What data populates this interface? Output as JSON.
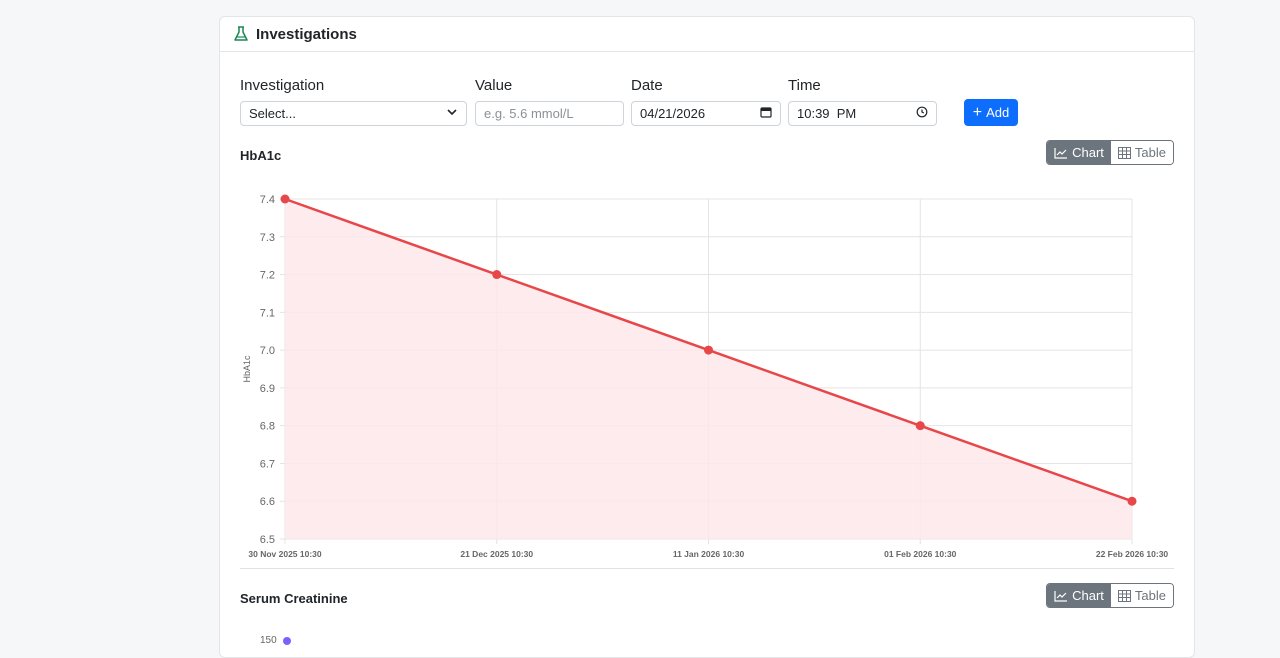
{
  "panel": {
    "title": "Investigations",
    "icon": "flask-icon"
  },
  "form": {
    "investigation_label": "Investigation",
    "investigation_value": "Select...",
    "value_label": "Value",
    "value_placeholder": "e.g. 5.6 mmol/L",
    "date_label": "Date",
    "date_value": "04/21/2026",
    "time_label": "Time",
    "time_value": "10:39  PM",
    "add_label": "Add"
  },
  "sections": [
    {
      "title": "HbA1c",
      "toggle": {
        "chart_label": "Chart",
        "table_label": "Table",
        "active": "chart"
      }
    },
    {
      "title": "Serum Creatinine",
      "toggle": {
        "chart_label": "Chart",
        "table_label": "Table",
        "active": "chart"
      },
      "partial_tick": "150"
    }
  ],
  "colors": {
    "line": "#e8474a",
    "fill": "#fde8ea",
    "primary": "#0d6efd",
    "secondary": "#6c757d"
  },
  "chart_data": {
    "type": "line",
    "x": [
      "30 Nov 2025 10:30",
      "21 Dec 2025 10:30",
      "11 Jan 2026 10:30",
      "01 Feb 2026 10:30",
      "22 Feb 2026 10:30"
    ],
    "series": [
      {
        "name": "",
        "values": [
          7.4,
          7.2,
          7.0,
          6.8,
          6.6
        ]
      }
    ],
    "ylabel": "HbA1c",
    "xlabel": "",
    "ylim": [
      6.5,
      7.4
    ],
    "yticks": [
      "7.4",
      "7.3",
      "7.2",
      "7.1",
      "7.0",
      "6.9",
      "6.8",
      "6.7",
      "6.6",
      "6.5"
    ],
    "grid": true,
    "fill_area": true
  }
}
